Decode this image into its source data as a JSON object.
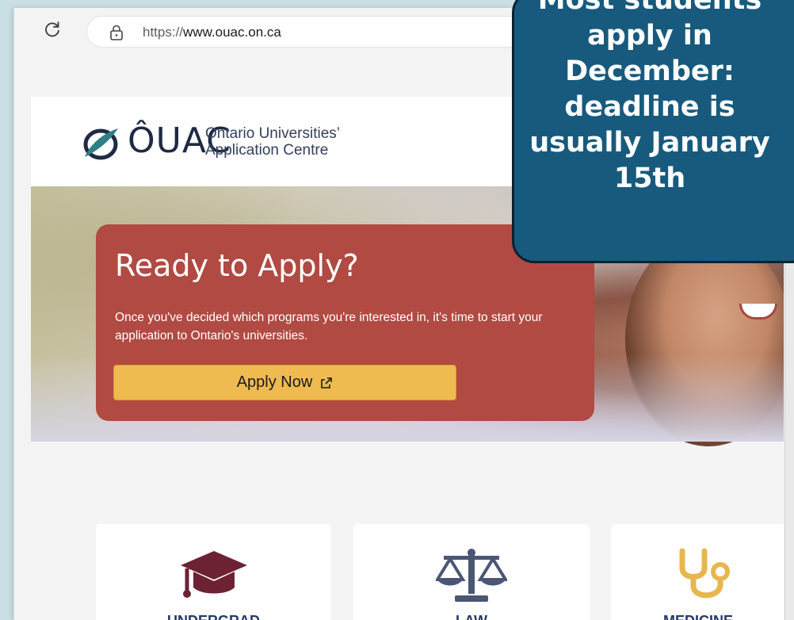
{
  "browser": {
    "url_scheme": "https://",
    "url_host": "www.ouac.on.ca"
  },
  "header": {
    "logo_text": "ÔUAC",
    "logo_sub_line1": "Ontario Universities’",
    "logo_sub_line2": "Application Centre"
  },
  "hero": {
    "title": "Ready to Apply?",
    "text": "Once you've decided which programs you're interested in, it's time to start your application to Ontario's universities.",
    "button_label": "Apply Now"
  },
  "cards": [
    {
      "label": "UNDERGRAD",
      "icon": "graduation-cap-icon",
      "color": "#6d2234"
    },
    {
      "label": "LAW",
      "icon": "scales-icon",
      "color": "#4a5672"
    },
    {
      "label": "MEDICINE",
      "icon": "stethoscope-icon",
      "color": "#e8b64f"
    }
  ],
  "callout": {
    "lines": [
      "Most students",
      "apply in",
      "December:",
      "deadline is",
      "usually January",
      "15th"
    ]
  },
  "colors": {
    "cta_background": "#b04a42",
    "button_background": "#efba50",
    "callout_background": "#175a7e",
    "card_label": "#243a66"
  }
}
